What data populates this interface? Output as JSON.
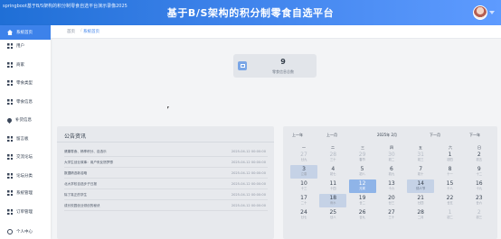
{
  "browser": {
    "tab_title": "springboot基于B/S架构的积分制零食自选平台演示录像2025"
  },
  "header": {
    "title": "基于B/S架构的积分制零食自选平台"
  },
  "sidebar": {
    "items": [
      {
        "label": "系统首页",
        "icon": "home-icon",
        "active": true
      },
      {
        "label": "用户",
        "icon": "grid-icon"
      },
      {
        "label": "商家",
        "icon": "grid-icon"
      },
      {
        "label": "零食类型",
        "icon": "grid-icon"
      },
      {
        "label": "零食信息",
        "icon": "grid-icon"
      },
      {
        "label": "补货信息",
        "icon": "pin-icon"
      },
      {
        "label": "留言板",
        "icon": "grid-icon"
      },
      {
        "label": "交流论坛",
        "icon": "grid-icon"
      },
      {
        "label": "论坛分类",
        "icon": "grid-icon"
      },
      {
        "label": "系统管理",
        "icon": "grid-icon"
      },
      {
        "label": "订单管理",
        "icon": "grid-icon"
      }
    ],
    "user_center": "个人中心"
  },
  "breadcrumb": {
    "home": "首页",
    "separator": "/",
    "current": "系统首页"
  },
  "stats": {
    "value": "9",
    "label": "零食信息总数"
  },
  "announcements": {
    "title": "公告资讯",
    "items": [
      {
        "title": "健康零食、畅享积分、自选乐",
        "date": "2025-04-12 00:00:00"
      },
      {
        "title": "大学生创业故事：用户来反馈梦想",
        "date": "2025-04-12 00:00:00"
      },
      {
        "title": "数据精选新名略",
        "date": "2025-04-12 00:00:00"
      },
      {
        "title": "北大学校自选步子日报",
        "date": "2025-04-12 00:00:00"
      },
      {
        "title": "除了真正的学生",
        "date": "2025-04-12 00:00:00"
      },
      {
        "title": "成长校园创业领创的秘诀",
        "date": "2025-04-12 00:00:00"
      }
    ]
  },
  "calendar": {
    "prev_year": "上一年",
    "prev_month": "上一月",
    "title": "2025年 2月",
    "next_month": "下一月",
    "next_year": "下一年",
    "weekdays": [
      "一",
      "二",
      "三",
      "四",
      "五",
      "六",
      "日"
    ],
    "weeks": [
      [
        {
          "n": "27",
          "s": "廿九",
          "o": true
        },
        {
          "n": "28",
          "s": "三十",
          "o": true
        },
        {
          "n": "29",
          "s": "春节",
          "o": true
        },
        {
          "n": "30",
          "s": "初二",
          "o": true
        },
        {
          "n": "31",
          "s": "初三",
          "o": true
        },
        {
          "n": "1",
          "s": "初四"
        },
        {
          "n": "2",
          "s": "初五"
        }
      ],
      [
        {
          "n": "3",
          "s": "立春",
          "k": "sel"
        },
        {
          "n": "4",
          "s": "初七"
        },
        {
          "n": "5",
          "s": "初八"
        },
        {
          "n": "6",
          "s": "初九"
        },
        {
          "n": "7",
          "s": "初十"
        },
        {
          "n": "8",
          "s": "十一"
        },
        {
          "n": "9",
          "s": "十二"
        }
      ],
      [
        {
          "n": "10",
          "s": "十三"
        },
        {
          "n": "11",
          "s": "十四"
        },
        {
          "n": "12",
          "s": "元宵",
          "k": "today"
        },
        {
          "n": "13",
          "s": "十六"
        },
        {
          "n": "14",
          "s": "情人节",
          "k": "hl"
        },
        {
          "n": "15",
          "s": "十八"
        },
        {
          "n": "16",
          "s": "十九"
        }
      ],
      [
        {
          "n": "17",
          "s": "二十"
        },
        {
          "n": "18",
          "s": "雨水",
          "k": "sel"
        },
        {
          "n": "19",
          "s": "廿二"
        },
        {
          "n": "20",
          "s": "廿三"
        },
        {
          "n": "21",
          "s": "廿四"
        },
        {
          "n": "22",
          "s": "廿五"
        },
        {
          "n": "23",
          "s": "廿六"
        }
      ],
      [
        {
          "n": "24",
          "s": "廿七"
        },
        {
          "n": "25",
          "s": "廿八"
        },
        {
          "n": "26",
          "s": "廿九"
        },
        {
          "n": "27",
          "s": "三十"
        },
        {
          "n": "28",
          "s": "二月"
        },
        {
          "n": "1",
          "s": "初二",
          "o": true
        },
        {
          "n": "2",
          "s": "初三",
          "o": true
        }
      ]
    ]
  }
}
